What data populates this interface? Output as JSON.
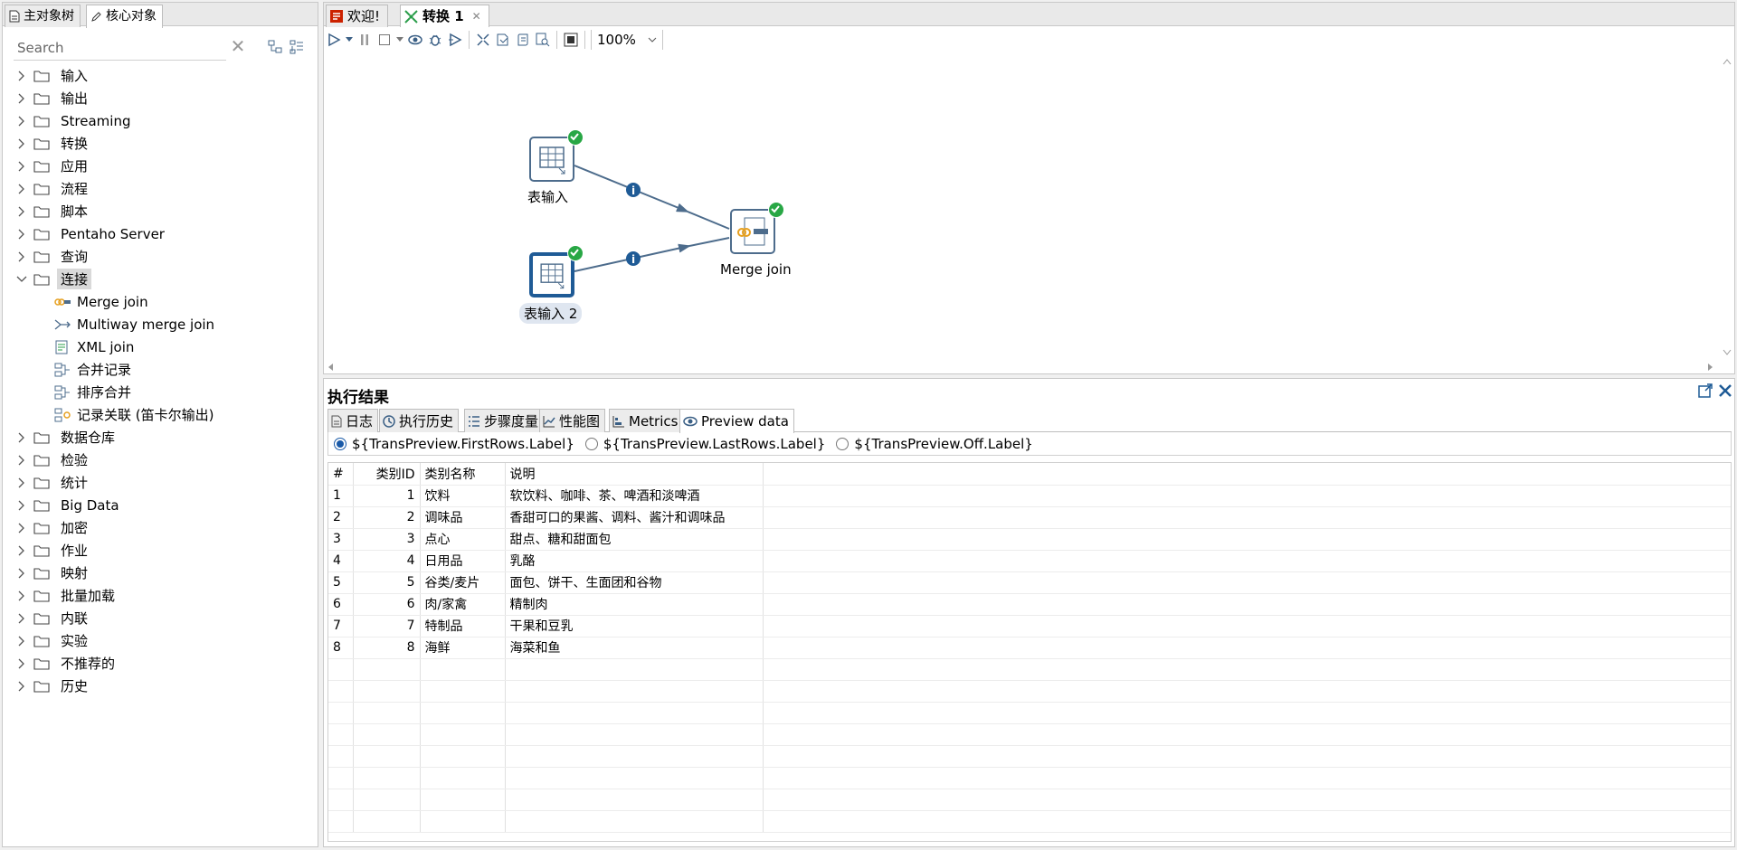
{
  "left_panel": {
    "tabs": [
      {
        "label": "主对象树",
        "icon": "document-icon"
      },
      {
        "label": "核心对象",
        "icon": "pencil-icon"
      }
    ],
    "search": {
      "placeholder": "Search",
      "value": ""
    },
    "tree": [
      {
        "label": "输入",
        "expanded": false
      },
      {
        "label": "输出",
        "expanded": false
      },
      {
        "label": "Streaming",
        "expanded": false
      },
      {
        "label": "转换",
        "expanded": false
      },
      {
        "label": "应用",
        "expanded": false
      },
      {
        "label": "流程",
        "expanded": false
      },
      {
        "label": "脚本",
        "expanded": false
      },
      {
        "label": "Pentaho Server",
        "expanded": false
      },
      {
        "label": "查询",
        "expanded": false
      },
      {
        "label": "连接",
        "expanded": true,
        "selected": true,
        "children": [
          "Merge join",
          "Multiway merge join",
          "XML join",
          "合并记录",
          "排序合并",
          "记录关联 (笛卡尔输出)"
        ]
      },
      {
        "label": "数据仓库",
        "expanded": false
      },
      {
        "label": "检验",
        "expanded": false
      },
      {
        "label": "统计",
        "expanded": false
      },
      {
        "label": "Big Data",
        "expanded": false
      },
      {
        "label": "加密",
        "expanded": false
      },
      {
        "label": "作业",
        "expanded": false
      },
      {
        "label": "映射",
        "expanded": false
      },
      {
        "label": "批量加载",
        "expanded": false
      },
      {
        "label": "内联",
        "expanded": false
      },
      {
        "label": "实验",
        "expanded": false
      },
      {
        "label": "不推荐的",
        "expanded": false
      },
      {
        "label": "历史",
        "expanded": false
      }
    ]
  },
  "editor": {
    "tabs": [
      {
        "label": "欢迎!",
        "icon": "welcome-icon"
      },
      {
        "label": "转换 1",
        "icon": "transformation-icon",
        "active": true
      }
    ],
    "zoom": "100%",
    "steps": [
      {
        "label": "表输入",
        "type": "table-input",
        "status": "ok"
      },
      {
        "label": "表输入 2",
        "type": "table-input",
        "status": "ok",
        "selected": true
      },
      {
        "label": "Merge join",
        "type": "merge-join",
        "status": "ok"
      }
    ],
    "hops": [
      {
        "from": "表输入",
        "to": "Merge join"
      },
      {
        "from": "表输入 2",
        "to": "Merge join"
      }
    ]
  },
  "results": {
    "title": "执行结果",
    "tabs": [
      {
        "label": "日志"
      },
      {
        "label": "执行历史"
      },
      {
        "label": "步骤度量"
      },
      {
        "label": "性能图"
      },
      {
        "label": "Metrics"
      },
      {
        "label": "Preview data",
        "active": true
      }
    ],
    "radio_options": [
      {
        "label": "${TransPreview.FirstRows.Label}",
        "checked": true
      },
      {
        "label": "${TransPreview.LastRows.Label}",
        "checked": false
      },
      {
        "label": "${TransPreview.Off.Label}",
        "checked": false
      }
    ],
    "table": {
      "columns": [
        "#",
        "类别ID",
        "类别名称",
        "说明"
      ],
      "rows": [
        [
          "1",
          "1",
          "饮料",
          "软饮料、咖啡、茶、啤酒和淡啤酒"
        ],
        [
          "2",
          "2",
          "调味品",
          "香甜可口的果酱、调料、酱汁和调味品"
        ],
        [
          "3",
          "3",
          "点心",
          "甜点、糖和甜面包"
        ],
        [
          "4",
          "4",
          "日用品",
          "乳酪"
        ],
        [
          "5",
          "5",
          "谷类/麦片",
          "面包、饼干、生面团和谷物"
        ],
        [
          "6",
          "6",
          "肉/家禽",
          "精制肉"
        ],
        [
          "7",
          "7",
          "特制品",
          "干果和豆乳"
        ],
        [
          "8",
          "8",
          "海鲜",
          "海菜和鱼"
        ]
      ]
    }
  },
  "colors": {
    "accent": "#1f5b96",
    "ok": "#28a745",
    "hop": "#4d6c8c"
  }
}
